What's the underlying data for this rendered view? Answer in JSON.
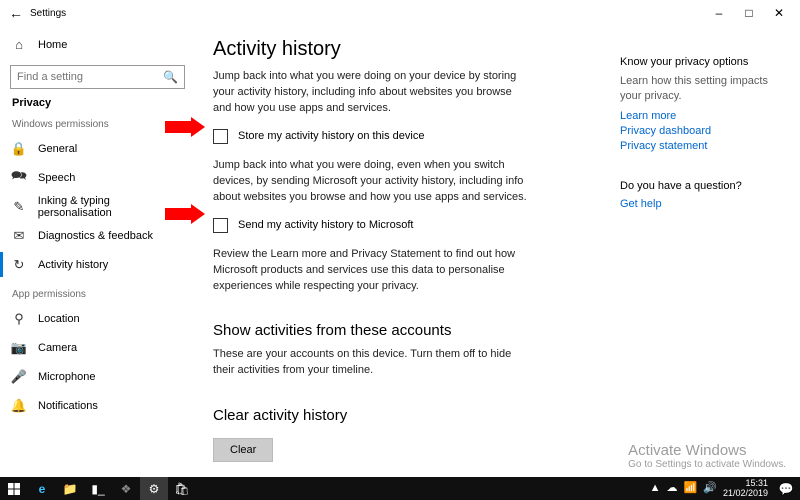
{
  "titlebar": {
    "title": "Settings"
  },
  "sidebar": {
    "home_label": "Home",
    "search_placeholder": "Find a setting",
    "category": "Privacy",
    "group1_heading": "Windows permissions",
    "group1": [
      {
        "label": "General"
      },
      {
        "label": "Speech"
      },
      {
        "label": "Inking & typing personalisation"
      },
      {
        "label": "Diagnostics & feedback"
      },
      {
        "label": "Activity history"
      }
    ],
    "group2_heading": "App permissions",
    "group2": [
      {
        "label": "Location"
      },
      {
        "label": "Camera"
      },
      {
        "label": "Microphone"
      },
      {
        "label": "Notifications"
      }
    ]
  },
  "main": {
    "title": "Activity history",
    "p1": "Jump back into what you were doing on your device by storing your activity history, including info about websites you browse and how you use apps and services.",
    "chk1": "Store my activity history on this device",
    "p2": "Jump back into what you were doing, even when you switch devices, by sending Microsoft your activity history, including info about websites you browse and how you use apps and services.",
    "chk2": "Send my activity history to Microsoft",
    "p3": "Review the Learn more and Privacy Statement to find out how Microsoft products and services use this data to personalise experiences while respecting your privacy.",
    "h2a": "Show activities from these accounts",
    "p4": "These are your accounts on this device. Turn them off to hide their activities from your timeline.",
    "h2b": "Clear activity history",
    "clear_btn": "Clear"
  },
  "right": {
    "h1": "Know your privacy options",
    "t1": "Learn how this setting impacts your privacy.",
    "links": [
      "Learn more",
      "Privacy dashboard",
      "Privacy statement"
    ],
    "h2": "Do you have a question?",
    "link2": "Get help"
  },
  "watermark": {
    "l1": "Activate Windows",
    "l2": "Go to Settings to activate Windows."
  },
  "taskbar": {
    "time": "15:31",
    "date": "21/02/2019"
  }
}
